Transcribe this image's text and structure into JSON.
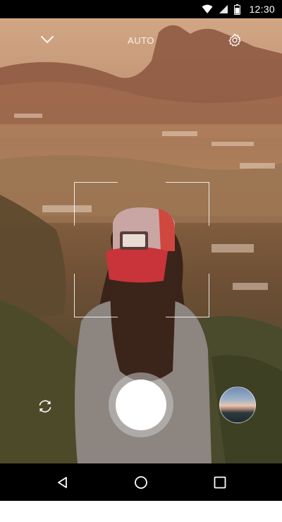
{
  "status_bar": {
    "time": "12:30",
    "icons": [
      "wifi-icon",
      "cell-signal-icon",
      "battery-icon"
    ],
    "background": "#000000"
  },
  "camera": {
    "flash_mode": "AUTO",
    "icons": {
      "collapse": "chevron-down-icon",
      "settings": "gear-icon",
      "switch_camera": "switch-camera-icon"
    },
    "shutter_color": "#ffffff"
  },
  "nav_bar": {
    "icons": [
      "back-icon",
      "home-icon",
      "recents-icon"
    ],
    "background": "#000000"
  }
}
